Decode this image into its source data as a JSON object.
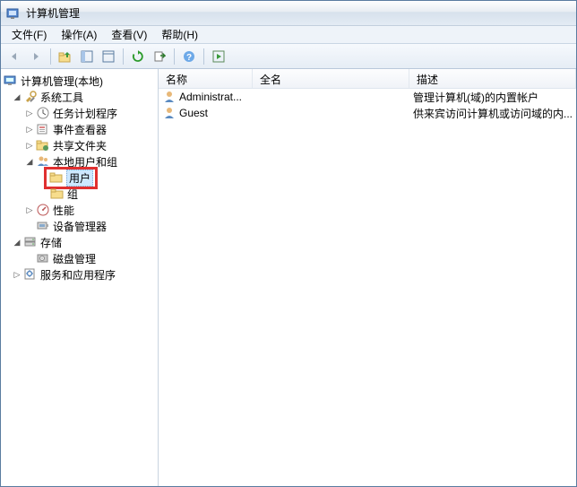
{
  "title": "计算机管理",
  "menus": {
    "file": "文件(F)",
    "action": "操作(A)",
    "view": "查看(V)",
    "help": "帮助(H)"
  },
  "tree": {
    "root": "计算机管理(本地)",
    "sys_tools": "系统工具",
    "task_sched": "任务计划程序",
    "event_viewer": "事件查看器",
    "shared_folders": "共享文件夹",
    "local_users": "本地用户和组",
    "users": "用户",
    "groups": "组",
    "performance": "性能",
    "device_mgr": "设备管理器",
    "storage": "存储",
    "disk_mgmt": "磁盘管理",
    "services_apps": "服务和应用程序"
  },
  "columns": {
    "name": "名称",
    "fullname": "全名",
    "desc": "描述"
  },
  "rows": [
    {
      "name": "Administrat...",
      "fullname": "",
      "desc": "管理计算机(域)的内置帐户"
    },
    {
      "name": "Guest",
      "fullname": "",
      "desc": "供来宾访问计算机或访问域的内..."
    }
  ]
}
